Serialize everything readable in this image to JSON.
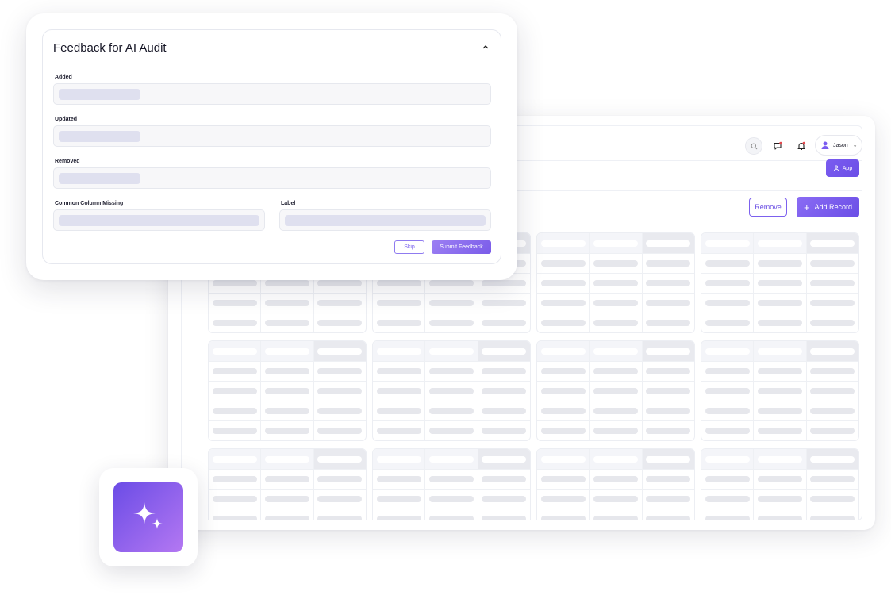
{
  "feedback_card": {
    "title": "Feedback for AI Audit",
    "fields": {
      "added_label": "Added",
      "updated_label": "Updated",
      "removed_label": "Removed",
      "common_column_missing_label": "Common Column Missing",
      "label_label": "Label"
    },
    "skip_label": "Skip",
    "submit_label": "Submit Feedback"
  },
  "app": {
    "user_name": "Jason",
    "app_button_label": "App",
    "remove_button_label": "Remove",
    "add_record_label": "Add Record",
    "accent_color": "#6b4ee6",
    "notification_color": "#e5484d"
  },
  "icons": {
    "search": "search-icon",
    "chat": "chat-icon",
    "bell": "bell-icon",
    "user": "user-icon",
    "plus": "plus-icon",
    "sparkle": "sparkle-icon",
    "chevron_up": "chevron-up-icon",
    "chevron_down": "chevron-down-icon"
  }
}
